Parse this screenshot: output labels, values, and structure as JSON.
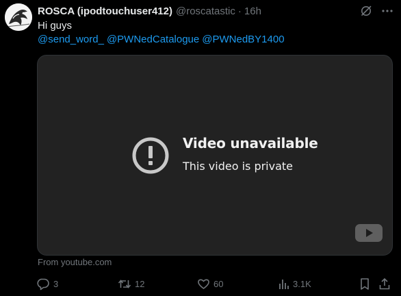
{
  "tweet": {
    "display_name": "ROSCA (ipodtouchuser412)",
    "handle": "@roscatastic",
    "separator": "·",
    "time": "16h",
    "text": "Hi guys",
    "mentions": [
      "@send_word_",
      "@PWNedCatalogue",
      "@PWNedBY1400"
    ],
    "avatar_icon": "avatar-illustration"
  },
  "video": {
    "error_title": "Video unavailable",
    "error_message": "This video is private",
    "source": "From youtube.com",
    "icons": [
      "error-icon",
      "youtube-icon"
    ]
  },
  "actions": {
    "reply_count": "3",
    "repost_count": "12",
    "like_count": "60",
    "views_count": "3.1K",
    "icons": [
      "reply-icon",
      "repost-icon",
      "like-icon",
      "views-icon",
      "bookmark-icon",
      "share-icon"
    ]
  },
  "colors": {
    "background": "#000000",
    "text": "#e7e9ea",
    "muted": "#71767b",
    "link": "#1d9bf0",
    "video_bg": "#222222"
  }
}
